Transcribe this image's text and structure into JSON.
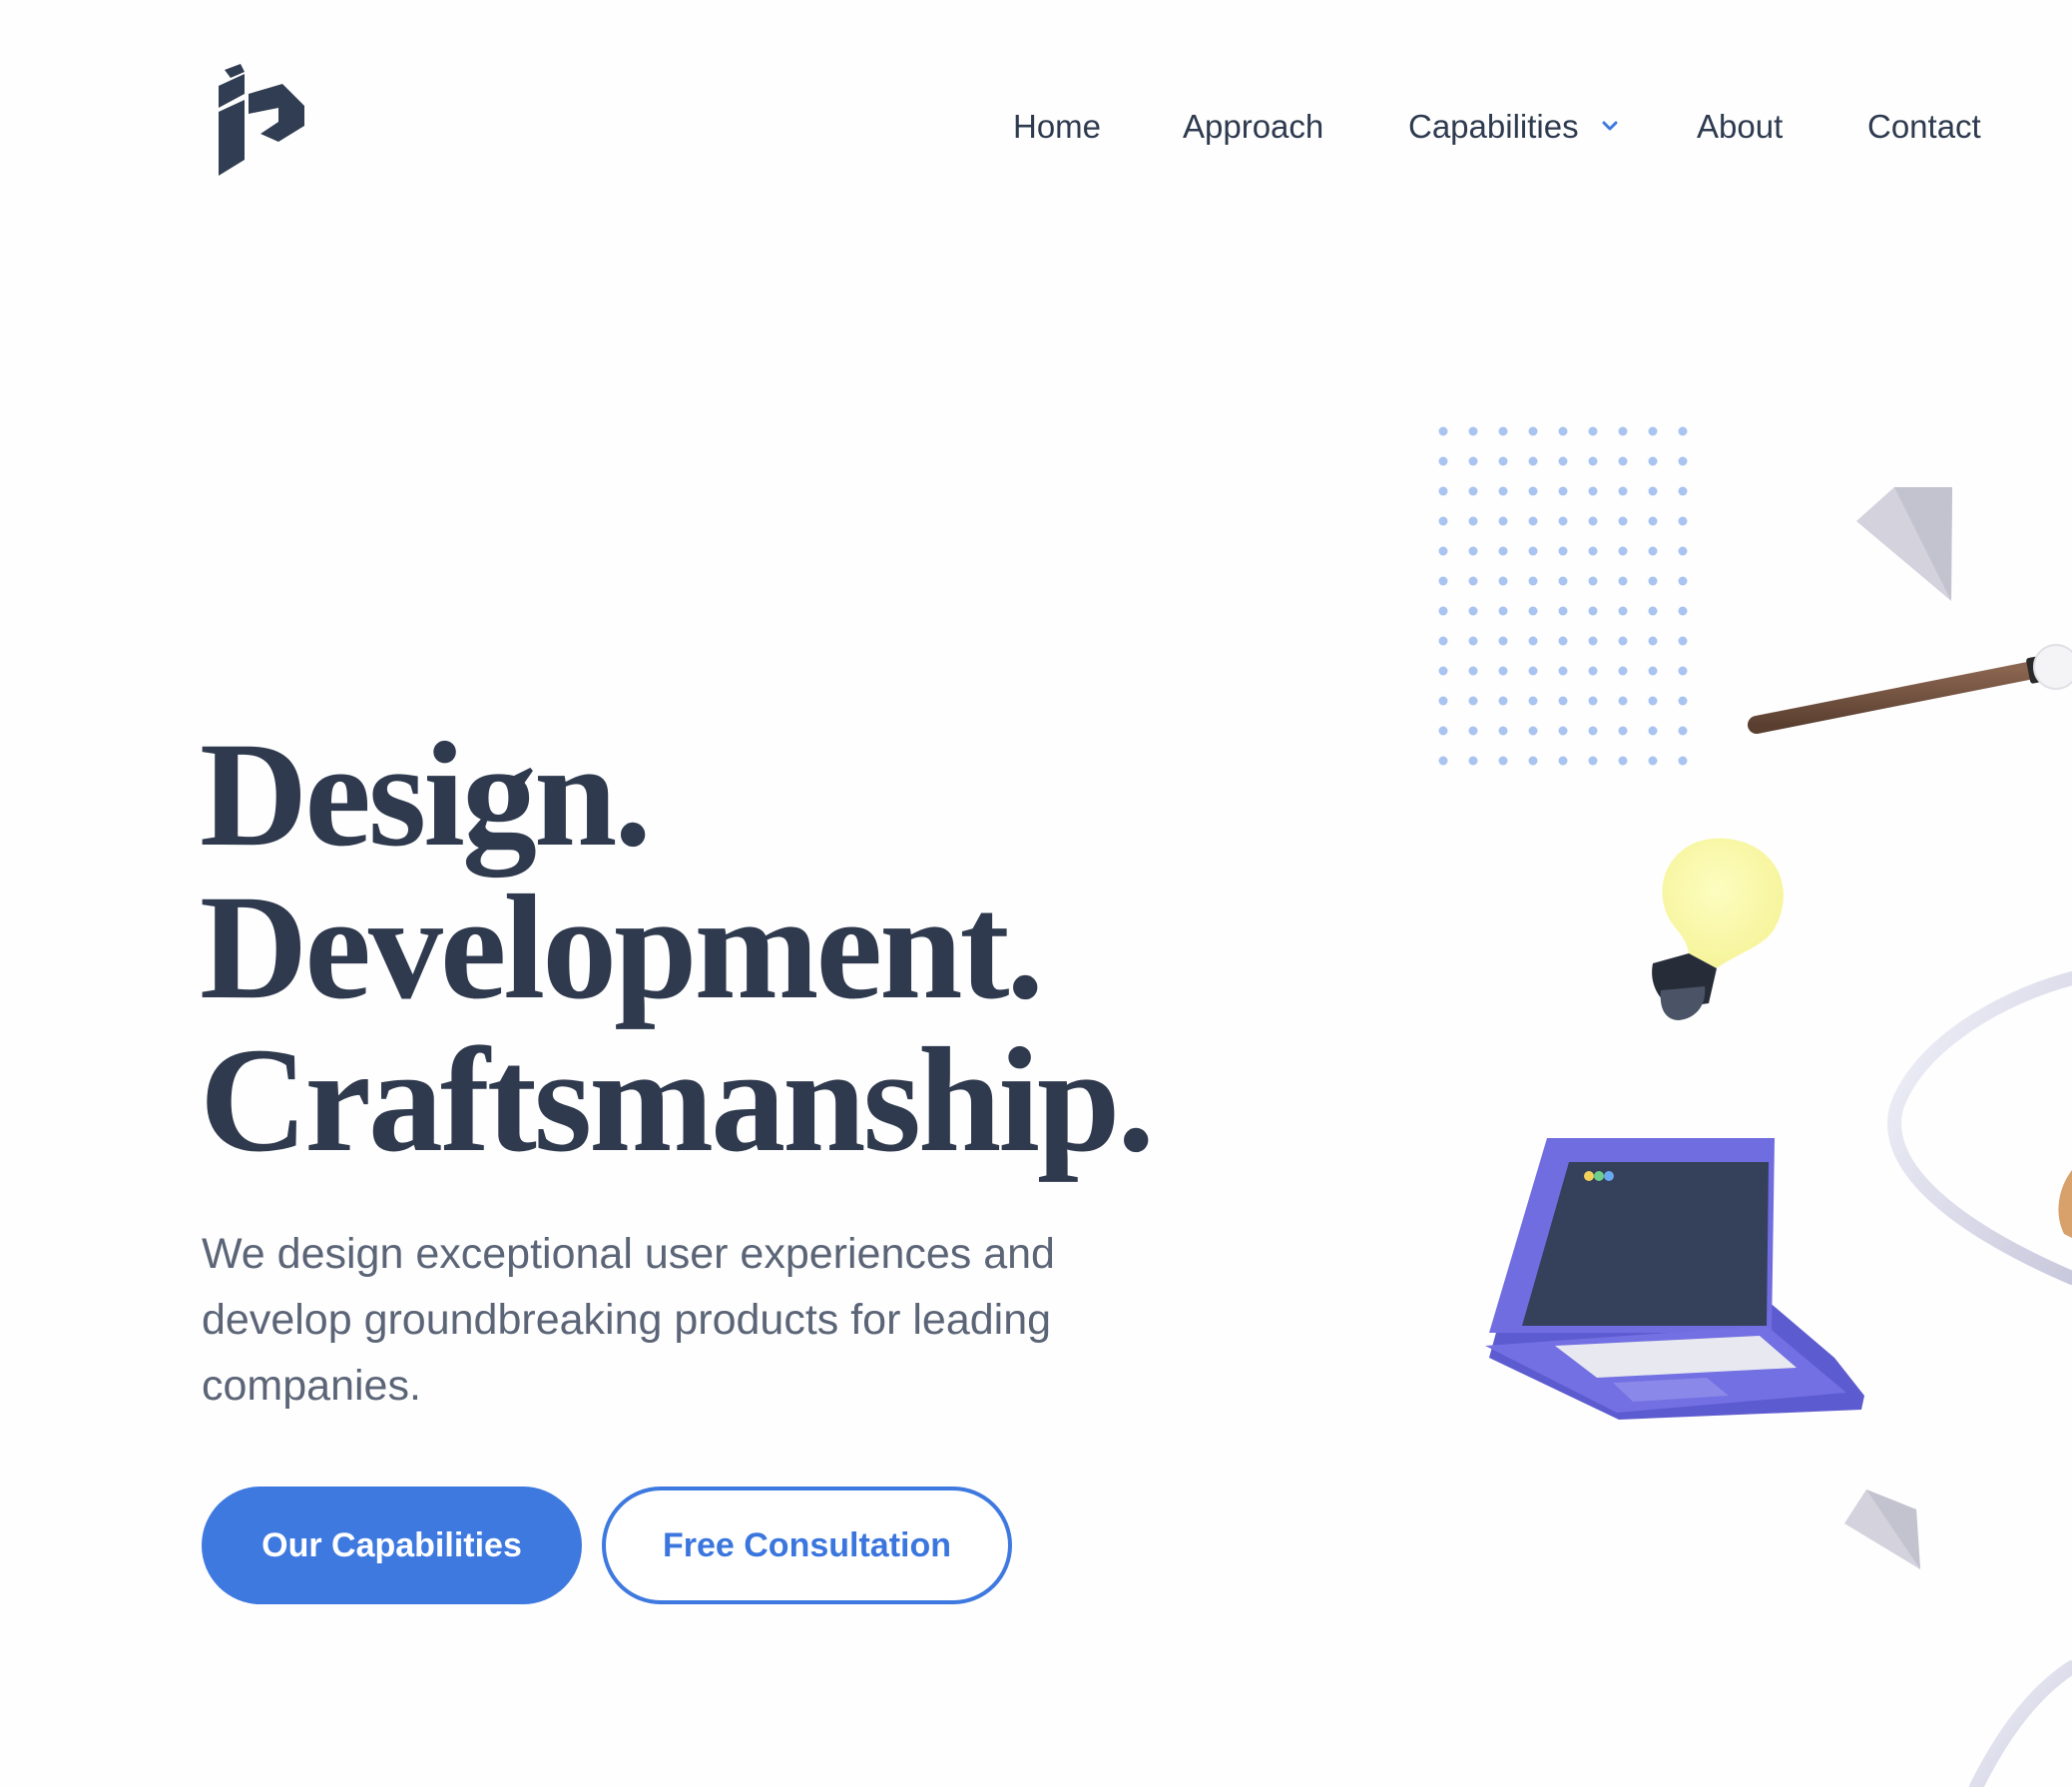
{
  "header": {
    "logo_icon": "brand-p-logo-icon",
    "nav": {
      "home": "Home",
      "approach": "Approach",
      "capabilities": "Capabilities",
      "capabilities_icon": "chevron-down-icon",
      "about": "About",
      "contact": "Contact"
    }
  },
  "hero": {
    "headline": [
      "Design.",
      "Development.",
      "Craftsmanship."
    ],
    "subtext": "We design exceptional user experiences and develop groundbreaking products for leading companies.",
    "primary_button": "Our Capabilities",
    "secondary_button": "Free Consultation"
  },
  "illustration": {
    "icons": [
      "dot-grid-pattern",
      "paper-pyramid-icon",
      "pencil-stick-icon",
      "lightbulb-icon",
      "laptop-icon",
      "ribbon-loop-icon"
    ]
  },
  "colors": {
    "text_dark": "#2f3a4e",
    "text_muted": "#5b6577",
    "accent_blue": "#3e79e0",
    "background": "#fefefe"
  }
}
